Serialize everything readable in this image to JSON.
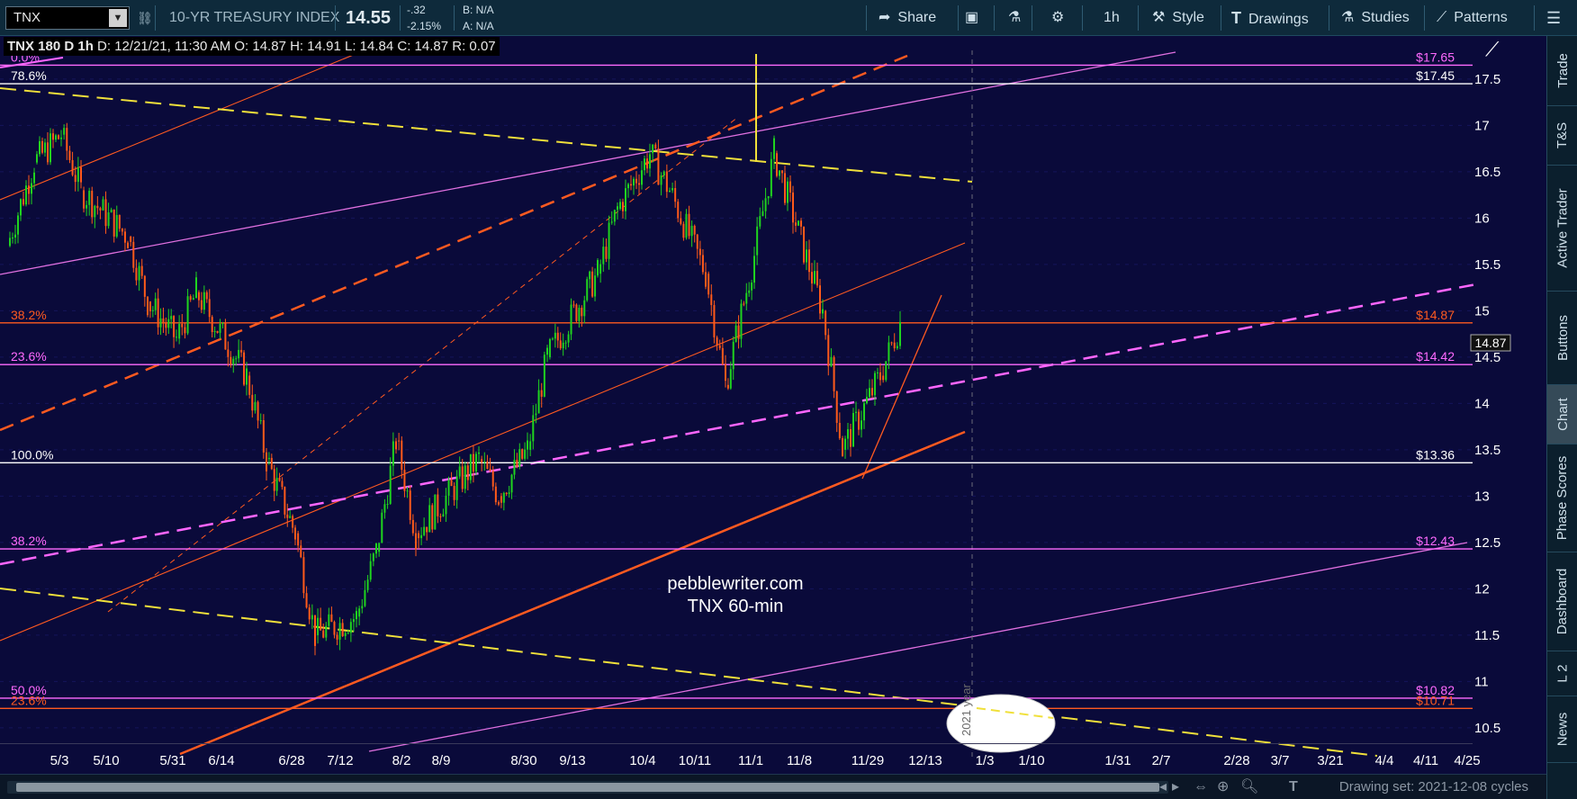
{
  "toolbar": {
    "symbol": "TNX",
    "index_name": "10-YR TREASURY INDEX",
    "last_price": "14.55",
    "change": "-.32",
    "change_pct": "-2.15%",
    "bid": "B: N/A",
    "ask": "A: N/A",
    "share_label": "Share",
    "interval_label": "1h",
    "style_label": "Style",
    "drawings_label": "Drawings",
    "studies_label": "Studies",
    "patterns_label": "Patterns"
  },
  "status_line": {
    "title": "TNX 180 D 1h",
    "date": "D: 12/21/21, 11:30 AM",
    "open": "O: 14.87",
    "high": "H: 14.91",
    "low": "L: 14.84",
    "close": "C: 14.87",
    "range": "R: 0.07"
  },
  "side_tabs": [
    "Trade",
    "T&S",
    "Active Trader",
    "Buttons",
    "Chart",
    "Phase Scores",
    "Dashboard",
    "L 2",
    "News"
  ],
  "bottom_bar": {
    "drawing_set": "Drawing set: 2021-12-08 cycles"
  },
  "watermark": {
    "line1": "pebblewriter.com",
    "line2": "TNX 60-min"
  },
  "year_marker": "2021 year",
  "current_price_label": "14.87",
  "colors": {
    "background": "#0a0a3a",
    "up_candle": "#1fd31f",
    "down_candle": "#ff5a1a",
    "fib_magenta": "#ff6aff",
    "fib_orange": "#ff5a20",
    "trend_yellow": "#f0e03a",
    "channel_orange": "#ff5a20",
    "channel_pink": "#ff66ff"
  },
  "chart_data": {
    "type": "line",
    "y_axis": {
      "range": [
        10.45,
        17.8
      ],
      "ticks": [
        10.5,
        11,
        11.5,
        12,
        12.5,
        13,
        13.5,
        14,
        14.5,
        15,
        15.5,
        16,
        16.5,
        17,
        17.5
      ]
    },
    "x_axis": {
      "ticks": [
        "5/3",
        "5/10",
        "5/31",
        "6/14",
        "6/28",
        "7/12",
        "8/2",
        "8/9",
        "8/30",
        "9/13",
        "10/4",
        "10/11",
        "11/1",
        "11/8",
        "11/29",
        "12/13",
        "1/3",
        "1/10",
        "1/31",
        "2/7",
        "2/28",
        "3/7",
        "3/21",
        "4/4",
        "4/11",
        "4/25"
      ]
    },
    "fib_levels": [
      {
        "label": "0.0%",
        "value": 17.65,
        "price_label": "$17.65",
        "color": "#ff6aff"
      },
      {
        "label": "78.6%",
        "value": 17.45,
        "price_label": "$17.45",
        "color": "#ffffff"
      },
      {
        "label": "38.2%",
        "value": 14.87,
        "price_label": "$14.87",
        "color": "#ff5a20"
      },
      {
        "label": "23.6%",
        "value": 14.42,
        "price_label": "$14.42",
        "color": "#ff6aff"
      },
      {
        "label": "100.0%",
        "value": 13.36,
        "price_label": "$13.36",
        "color": "#ffffff"
      },
      {
        "label": "38.2%",
        "value": 12.43,
        "price_label": "$12.43",
        "color": "#ff6aff"
      },
      {
        "label": "50.0%",
        "value": 10.82,
        "price_label": "$10.82",
        "color": "#ff6aff"
      },
      {
        "label": "23.6%",
        "value": 10.71,
        "price_label": "$10.71",
        "color": "#ff5a20"
      }
    ],
    "price_path": {
      "name": "TNX",
      "points": [
        [
          "5/3",
          15.7
        ],
        [
          "5/3",
          16.6
        ],
        [
          "5/10",
          16.9
        ],
        [
          "5/10",
          16.3
        ],
        [
          "5/31",
          15.8
        ],
        [
          "5/31",
          15.1
        ],
        [
          "6/14",
          14.7
        ],
        [
          "6/14",
          15.2
        ],
        [
          "6/28",
          14.3
        ],
        [
          "6/28",
          13.4
        ],
        [
          "7/12",
          12.6
        ],
        [
          "7/12",
          11.5
        ],
        [
          "8/2",
          11.7
        ],
        [
          "8/2",
          12.4
        ],
        [
          "8/9",
          13.6
        ],
        [
          "8/9",
          12.6
        ],
        [
          "8/30",
          13.4
        ],
        [
          "8/30",
          13.0
        ],
        [
          "9/13",
          13.5
        ],
        [
          "9/13",
          14.5
        ],
        [
          "10/4",
          15.4
        ],
        [
          "10/4",
          16.1
        ],
        [
          "10/11",
          16.7
        ],
        [
          "10/11",
          16.3
        ],
        [
          "11/1",
          15.4
        ],
        [
          "11/1",
          14.2
        ],
        [
          "11/8",
          15.6
        ],
        [
          "11/8",
          16.7
        ],
        [
          "11/29",
          15.0
        ],
        [
          "11/29",
          13.5
        ],
        [
          "12/13",
          14.3
        ],
        [
          "12/13",
          14.87
        ]
      ]
    },
    "annotations": [
      {
        "text": "pebblewriter.com"
      },
      {
        "text": "TNX 60-min"
      }
    ]
  }
}
